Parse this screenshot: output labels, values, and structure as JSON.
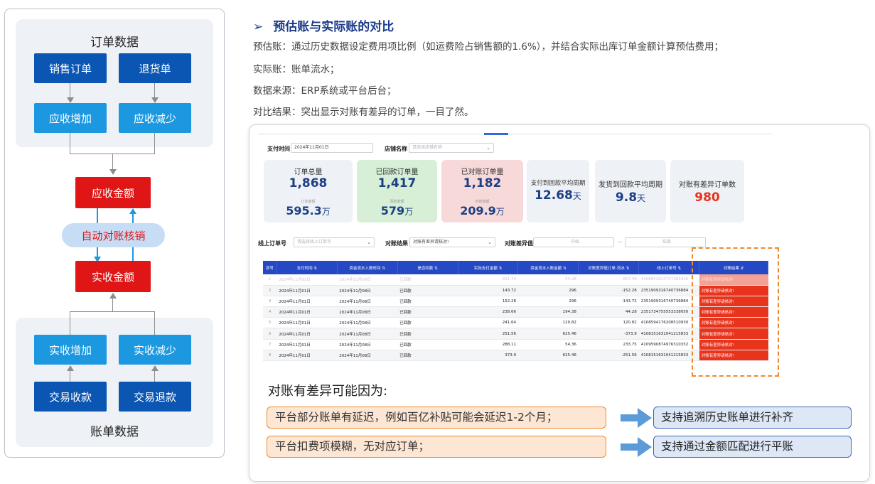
{
  "flow": {
    "order_data_title": "订单数据",
    "bill_data_title": "账单数据",
    "sales_order": "销售订单",
    "return_order": "退货单",
    "receivable_increase": "应收增加",
    "receivable_decrease": "应收减少",
    "receivable_amount": "应收金额",
    "auto_reconcile": "自动对账核销",
    "received_amount": "实收金额",
    "received_increase": "实收增加",
    "received_decrease": "实收减少",
    "trade_receipt": "交易收款",
    "trade_refund": "交易退款"
  },
  "section": {
    "arrow": "➢",
    "title": "预估账与实际账的对比",
    "line1": "预估账：通过历史数据设定费用项比例（如运费险占销售额的1.6%），并结合实际出库订单金额计算预估费用；",
    "line2": "实际账：账单流水；",
    "line3": "数据来源：ERP系统或平台后台；",
    "line4": "对比结果：突出显示对账有差异的订单，一目了然。"
  },
  "filters": {
    "pay_time_label": "支付时间",
    "pay_time_value": "2024年11月01日",
    "shop_label": "店铺名称",
    "shop_placeholder": "请选择店铺名称",
    "online_order_label": "线上订单号",
    "online_order_placeholder": "请选择线上订单号",
    "result_label": "对账结果",
    "result_value": "对账有差异请核对!",
    "diff_label": "对账差异值",
    "diff_start": "开始",
    "diff_sep": "~",
    "diff_end": "结束"
  },
  "kpis": {
    "order_total_label": "订单总量",
    "order_total_value": "1,868",
    "order_amount_label": "订单金额",
    "order_amount_value": "595.3",
    "unit_wan": "万",
    "returned_label": "已回款订单量",
    "returned_value": "1,417",
    "returned_amount_label": "回款金额",
    "returned_amount_value": "579",
    "reconciled_label": "已对账订单量",
    "reconciled_value": "1,182",
    "reconciled_amount_label": "对账金额",
    "reconciled_amount_value": "209.9",
    "pay_to_return_label": "支付到回款平均周期",
    "pay_to_return_value": "12.68",
    "ship_to_return_label": "发货到回款平均周期",
    "ship_to_return_value": "9.8",
    "unit_day": "天",
    "diff_orders_label": "对账有差异订单数",
    "diff_orders_value": "980"
  },
  "table": {
    "headers": [
      "序号",
      "支付时间 ⇅",
      "资金流水入账时间 ⇅",
      "是否回款 ⇅",
      "实际支付金额 ⇅",
      "资金流水入账金额 ⇅",
      "对账差异值订单-流水 ⇅",
      "线上订单号 ⇅",
      "对账结果 ⇵"
    ],
    "rows": [
      [
        "1",
        "2024年11月01日",
        "2024年11月08日",
        "已回款",
        "911.74",
        "54.28",
        "857.46",
        "4108852913757284926",
        "对账有差异请核对!"
      ],
      [
        "2",
        "2024年11月01日",
        "2024年11月08日",
        "已回款",
        "143.72",
        "296",
        "-152.28",
        "2351909316740736884",
        "对账有差异请核对!"
      ],
      [
        "3",
        "2024年11月01日",
        "2024年11月08日",
        "已回款",
        "152.28",
        "296",
        "-143.72",
        "2351909316740736884",
        "对账有差异请核对!"
      ],
      [
        "4",
        "2024年11月01日",
        "2024年11月08日",
        "已回款",
        "238.66",
        "194.38",
        "44.28",
        "2351734755553338050",
        "对账有差异请核对!"
      ],
      [
        "5",
        "2024年11月01日",
        "2024年11月08日",
        "已回款",
        "241.64",
        "120.82",
        "120.82",
        "4108594176208510930",
        "对账有差异请核对!"
      ],
      [
        "6",
        "2024年11月01日",
        "2024年11月08日",
        "已回款",
        "251.56",
        "625.46",
        "-373.9",
        "4108151631041215833",
        "对账有差异请核对!"
      ],
      [
        "7",
        "2024年11月01日",
        "2024年11月08日",
        "已回款",
        "288.11",
        "54.36",
        "233.75",
        "4109590874976310332",
        "对账有差异请核对!"
      ],
      [
        "8",
        "2024年11月01日",
        "2024年11月08日",
        "已回款",
        "373.9",
        "625.46",
        "-251.56",
        "4108151631041215833",
        "对账有差异请核对!"
      ]
    ]
  },
  "reasons": {
    "title": "对账有差异可能因为:",
    "r1": "平台部分账单有延迟，例如百亿补贴可能会延迟1-2个月；",
    "r2": "平台扣费项模糊，无对应订单；",
    "s1": "支持追溯历史账单进行补齐",
    "s2": "支持通过金额匹配进行平账"
  },
  "colors": {
    "dark_blue": "#0b56b3",
    "light_blue": "#1b98e0",
    "red": "#e01515",
    "header_blue": "#2549c4",
    "diff_red": "#e8341c",
    "orange": "#ee8a2c"
  }
}
